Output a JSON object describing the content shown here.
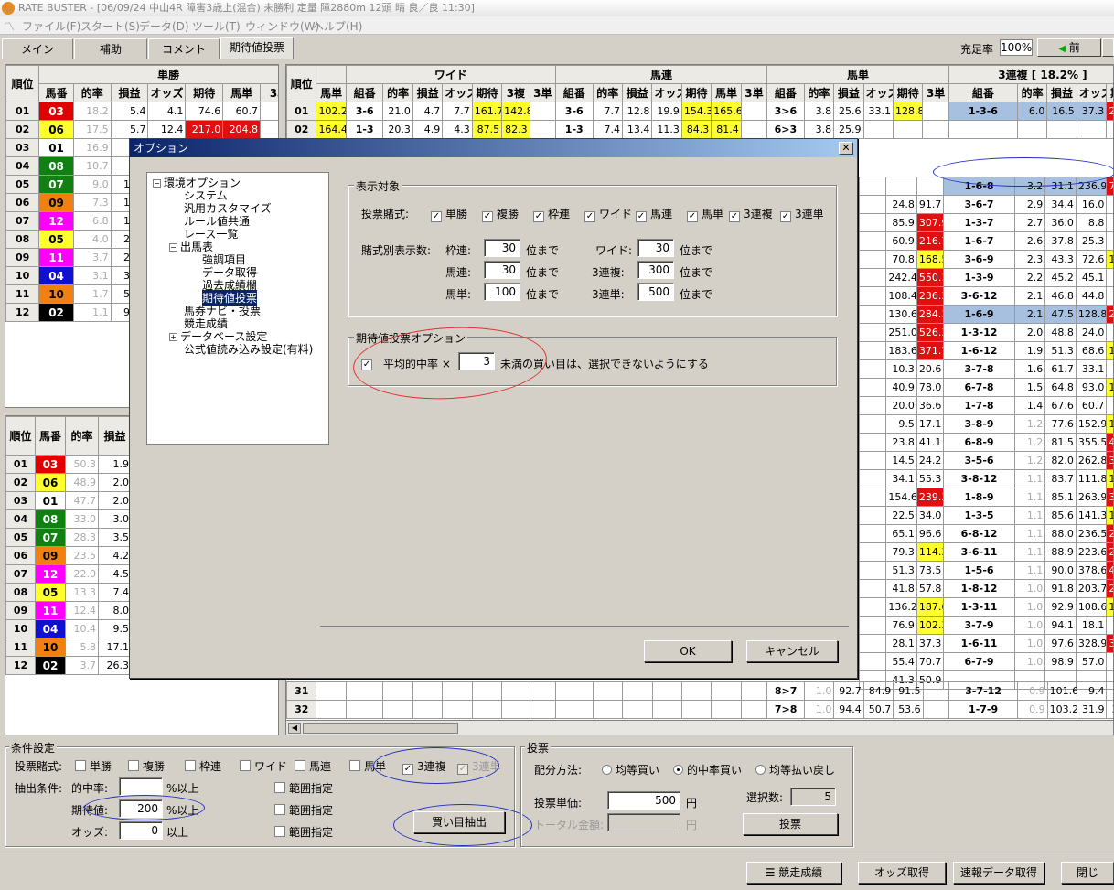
{
  "window": {
    "title": "RATE BUSTER - [06/09/24 中山4R 障害3歳上(混合) 未勝利 定量 障2880m  12頭 晴 良／良 11:30]"
  },
  "menu": [
    "ファイル(F)",
    "スタート(S)",
    "データ(D)",
    "ツール(T)",
    "ウィンドウ(W)",
    "ヘルプ(H)"
  ],
  "tabs": [
    "メイン",
    "補助",
    "コメント",
    "期待値投票"
  ],
  "fill_rate": {
    "label": "充足率",
    "value": "100%"
  },
  "prev_button": "前",
  "tansho": {
    "group": "単勝",
    "headers": [
      "順位",
      "馬番",
      "的率",
      "損益",
      "オッズ",
      "期待",
      "馬単",
      "3単"
    ],
    "rows": [
      [
        "01",
        "03",
        "18.2",
        "5.4",
        "4.1",
        "74.6",
        "60.7",
        ""
      ],
      [
        "02",
        "06",
        "17.5",
        "5.7",
        "12.4",
        "217.0",
        "204.8",
        ""
      ],
      [
        "03",
        "01",
        "16.9",
        "5.9",
        "",
        "",
        "",
        ""
      ],
      [
        "04",
        "08",
        "10.7",
        "9.3",
        "",
        "",
        "",
        ""
      ],
      [
        "05",
        "07",
        "9.0",
        "11.1",
        "",
        "",
        "",
        ""
      ],
      [
        "06",
        "09",
        "7.3",
        "13.6",
        "",
        "",
        "",
        ""
      ],
      [
        "07",
        "12",
        "6.8",
        "14.7",
        "",
        "",
        "",
        ""
      ],
      [
        "08",
        "05",
        "4.0",
        "25.0",
        "",
        "",
        "",
        ""
      ],
      [
        "09",
        "11",
        "3.7",
        "27.0",
        "",
        "",
        "",
        ""
      ],
      [
        "10",
        "04",
        "3.1",
        "32.2",
        "",
        "",
        "",
        ""
      ],
      [
        "11",
        "10",
        "1.7",
        "58.8",
        "",
        "",
        "",
        ""
      ],
      [
        "12",
        "02",
        "1.1",
        "90.9",
        "",
        "",
        "",
        ""
      ]
    ]
  },
  "fukusho": {
    "headers": [
      "順位",
      "馬番",
      "的率",
      "損益"
    ],
    "rows": [
      [
        "01",
        "03",
        "50.3",
        "1.9"
      ],
      [
        "02",
        "06",
        "48.9",
        "2.0"
      ],
      [
        "03",
        "01",
        "47.7",
        "2.0"
      ],
      [
        "04",
        "08",
        "33.0",
        "3.0"
      ],
      [
        "05",
        "07",
        "28.3",
        "3.5"
      ],
      [
        "06",
        "09",
        "23.5",
        "4.2"
      ],
      [
        "07",
        "12",
        "22.0",
        "4.5"
      ],
      [
        "08",
        "05",
        "13.3",
        "7.4"
      ],
      [
        "09",
        "11",
        "12.4",
        "8.0"
      ],
      [
        "10",
        "04",
        "10.4",
        "9.5"
      ],
      [
        "11",
        "10",
        "5.8",
        "17.1"
      ],
      [
        "12",
        "02",
        "3.7",
        "26.3"
      ]
    ]
  },
  "main_table": {
    "groups": [
      "ワイド",
      "馬連",
      "馬単",
      "3連複 [ 18.2% ]"
    ],
    "rank_header": "順位",
    "headers": [
      "馬単",
      "組番",
      "的率",
      "損益",
      "オッズ",
      "期待",
      "3複",
      "3単",
      "組番",
      "的率",
      "損益",
      "オッズ",
      "期待",
      "馬単",
      "3単",
      "組番",
      "的率",
      "損益",
      "オッズ",
      "期待",
      "3単",
      "組番",
      "的率",
      "損益",
      "オッズ",
      "期待"
    ],
    "top_rows": [
      [
        "01",
        "102.2",
        "3-6",
        "21.0",
        "4.7",
        "7.7",
        "161.7",
        "142.8",
        "",
        "3-6",
        "7.7",
        "12.8",
        "19.9",
        "154.3",
        "165.6",
        "",
        "3>6",
        "3.8",
        "25.6",
        "33.1",
        "128.8",
        "",
        "1-3-6",
        "6.0",
        "16.5",
        "37.3",
        "224.1"
      ],
      [
        "02",
        "164.4",
        "1-3",
        "20.3",
        "4.9",
        "4.3",
        "87.5",
        "82.3",
        "",
        "1-3",
        "7.4",
        "13.4",
        "11.3",
        "84.3",
        "81.4",
        "",
        "6>3",
        "3.8",
        "25.9",
        "",
        "",
        "",
        "",
        "",
        "",
        "",
        ""
      ]
    ],
    "right_rows": [
      [
        "",
        "",
        "1-6-8",
        "3.2",
        "31.1",
        "236.9",
        "760.0"
      ],
      [
        "24.8",
        "91.7",
        "3-6-7",
        "2.9",
        "34.4",
        "16.0",
        "46.4"
      ],
      [
        "85.9",
        "307.9",
        "1-3-7",
        "2.7",
        "36.0",
        "8.8",
        "24.4"
      ],
      [
        "60.9",
        "216.7",
        "1-6-7",
        "2.6",
        "37.8",
        "25.3",
        "66.8"
      ],
      [
        "70.8",
        "168.5",
        "3-6-9",
        "2.3",
        "43.3",
        "72.6",
        "167.4"
      ],
      [
        "242.4",
        "550.1",
        "1-3-9",
        "2.2",
        "45.2",
        "45.1",
        "99.6"
      ],
      [
        "108.4",
        "236.3",
        "3-6-12",
        "2.1",
        "46.8",
        "44.8",
        "95.7"
      ],
      [
        "130.6",
        "284.1",
        "1-6-9",
        "2.1",
        "47.5",
        "128.8",
        "270.1"
      ],
      [
        "251.0",
        "526.3",
        "1-3-12",
        "2.0",
        "48.8",
        "24.0",
        "49.1"
      ],
      [
        "183.6",
        "371.7",
        "1-6-12",
        "1.9",
        "51.3",
        "68.6",
        "133.6"
      ],
      [
        "10.3",
        "20.6",
        "3-7-8",
        "1.6",
        "61.7",
        "33.1",
        "53.6"
      ],
      [
        "40.9",
        "78.0",
        "6-7-8",
        "1.5",
        "64.8",
        "93.0",
        "143.4"
      ],
      [
        "20.0",
        "36.6",
        "1-7-8",
        "1.4",
        "67.6",
        "60.7",
        "89.6"
      ],
      [
        "9.5",
        "17.1",
        "3-8-9",
        "1.2",
        "77.6",
        "152.9",
        "197.0"
      ],
      [
        "23.8",
        "41.1",
        "6-8-9",
        "1.2",
        "81.5",
        "355.5",
        "436.1"
      ],
      [
        "14.5",
        "24.2",
        "3-5-6",
        "1.2",
        "82.0",
        "262.8",
        "320.4"
      ],
      [
        "34.1",
        "55.3",
        "3-8-12",
        "1.1",
        "83.7",
        "111.8",
        "133.4"
      ],
      [
        "154.6",
        "239.3",
        "1-8-9",
        "1.1",
        "85.1",
        "263.9",
        "310.0"
      ],
      [
        "22.5",
        "34.0",
        "1-3-5",
        "1.1",
        "85.6",
        "141.3",
        "164.9"
      ],
      [
        "65.1",
        "96.6",
        "6-8-12",
        "1.1",
        "88.0",
        "236.5",
        "268.7"
      ],
      [
        "79.3",
        "114.3",
        "3-6-11",
        "1.1",
        "88.9",
        "223.6",
        "251.5"
      ],
      [
        "51.3",
        "73.5",
        "1-5-6",
        "1.1",
        "90.0",
        "378.6",
        "420.6"
      ],
      [
        "41.8",
        "57.8",
        "1-8-12",
        "1.0",
        "91.8",
        "203.7",
        "221.8"
      ],
      [
        "136.2",
        "187.6",
        "1-3-11",
        "1.0",
        "92.9",
        "108.6",
        "116.8"
      ],
      [
        "76.9",
        "102.3",
        "3-7-9",
        "1.0",
        "94.1",
        "18.1",
        "19.2"
      ],
      [
        "28.1",
        "37.3",
        "1-6-11",
        "1.0",
        "97.6",
        "328.9",
        "336.9"
      ],
      [
        "55.4",
        "70.7",
        "6-7-9",
        "1.0",
        "98.9",
        "57.0",
        "57.6"
      ],
      [
        "41.3",
        "50.9",
        "",
        "",
        "",
        "",
        ""
      ]
    ],
    "bottom_rows": [
      [
        "31",
        "8>7",
        "1.0",
        "92.7",
        "84.9",
        "91.5",
        "3-7-12",
        "0.9",
        "101.6",
        "9.4",
        "9.2"
      ],
      [
        "32",
        "7>8",
        "1.0",
        "94.4",
        "50.7",
        "53.6",
        "1-7-9",
        "0.9",
        "103.2",
        "31.9",
        "30.8"
      ]
    ]
  },
  "dialog": {
    "title": "オプション",
    "tree": [
      "環境オプション",
      "システム",
      "汎用カスタマイズ",
      "ルール値共通",
      "レース一覧",
      "出馬表",
      "強調項目",
      "データ取得",
      "過去成績欄",
      "期待値投票",
      "馬券ナビ・投票",
      "競走成績",
      "データベース設定",
      "公式値読み込み設定(有料)"
    ],
    "display_group": "表示対象",
    "bet_type_label": "投票賭式:",
    "bet_types": [
      "単勝",
      "複勝",
      "枠連",
      "ワイド",
      "馬連",
      "馬単",
      "3連複",
      "3連単"
    ],
    "count_label": "賭式別表示数:",
    "counts": [
      {
        "label": "枠連:",
        "value": "30",
        "suffix": "位まで"
      },
      {
        "label": "ワイド:",
        "value": "30",
        "suffix": "位まで"
      },
      {
        "label": "馬連:",
        "value": "30",
        "suffix": "位まで"
      },
      {
        "label": "3連複:",
        "value": "300",
        "suffix": "位まで"
      },
      {
        "label": "馬単:",
        "value": "100",
        "suffix": "位まで"
      },
      {
        "label": "3連単:",
        "value": "500",
        "suffix": "位まで"
      }
    ],
    "ev_group": "期待値投票オプション",
    "ev_label": "平均的中率 ×",
    "ev_value": "3",
    "ev_suffix": "未満の買い目は、選択できないようにする",
    "ok": "OK",
    "cancel": "キャンセル"
  },
  "conditions": {
    "group": "条件設定",
    "bet_label": "投票賭式:",
    "bet_types": [
      "単勝",
      "複勝",
      "枠連",
      "ワイド",
      "馬連",
      "馬単",
      "3連複",
      "3連単"
    ],
    "extract_label": "抽出条件:",
    "rows": [
      {
        "label": "的中率:",
        "value": "",
        "suffix": "%以上",
        "range": "範囲指定"
      },
      {
        "label": "期待値:",
        "value": "200",
        "suffix": "%以上",
        "range": "範囲指定"
      },
      {
        "label": "オッズ:",
        "value": "0",
        "suffix": "以上",
        "range": "範囲指定"
      }
    ],
    "extract_button": "買い目抽出"
  },
  "vote": {
    "group": "投票",
    "method_label": "配分方法:",
    "methods": [
      "均等買い",
      "的中率買い",
      "均等払い戻し"
    ],
    "unit_label": "投票単価:",
    "unit_value": "500",
    "unit_suffix": "円",
    "total_label": "トータル金額:",
    "total_suffix": "円",
    "selected_label": "選択数:",
    "selected_value": "5",
    "vote_button": "投票"
  },
  "status_buttons": [
    "競走成績",
    "オッズ取得",
    "速報データ取得",
    "閉じ"
  ]
}
